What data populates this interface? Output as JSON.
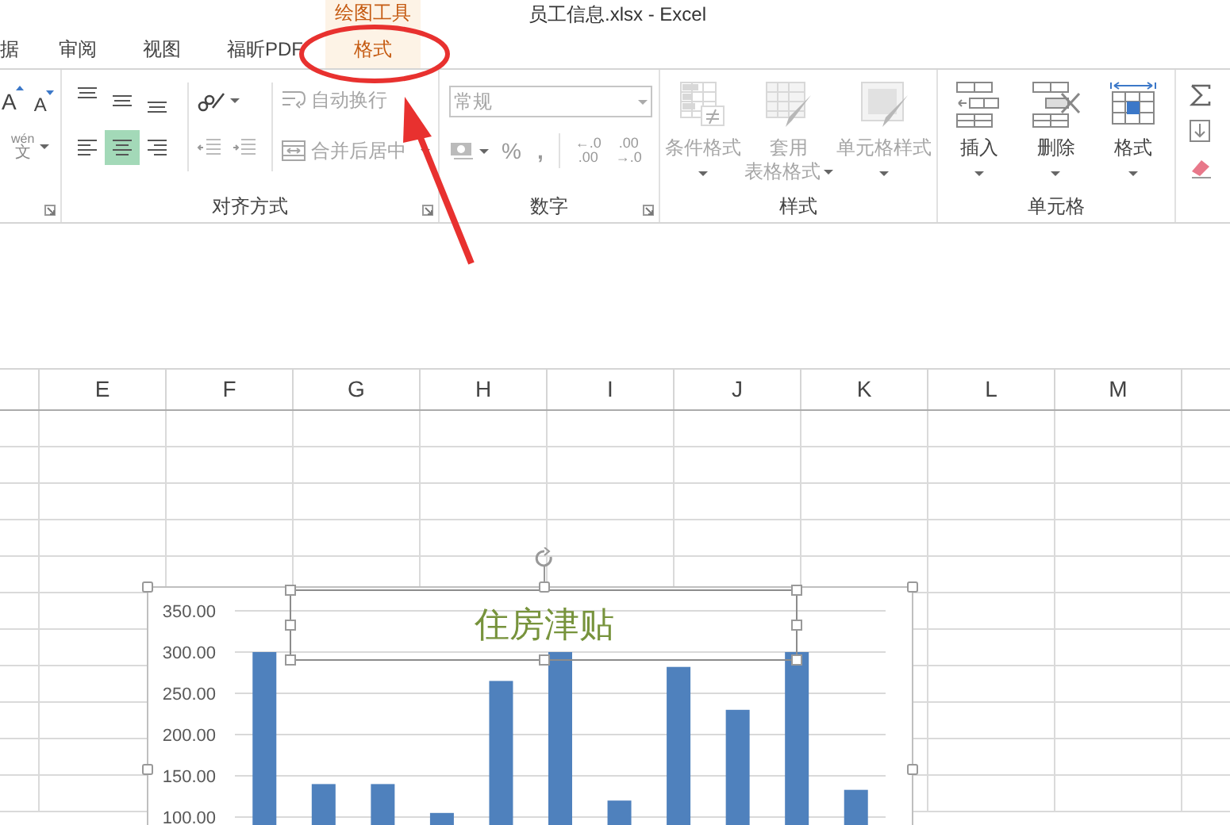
{
  "title_bar": {
    "context_label": "绘图工具",
    "title": "员工信息.xlsx - Excel"
  },
  "tabs": [
    {
      "label": "据",
      "selected": false
    },
    {
      "label": "审阅",
      "selected": false
    },
    {
      "label": "视图",
      "selected": false
    },
    {
      "label": "福昕PDF",
      "selected": false
    },
    {
      "label": "格式",
      "selected": true
    }
  ],
  "ribbon": {
    "font_group": {
      "grow_font": "A",
      "shrink_font": "A",
      "phonetic_top": "wén",
      "phonetic_bottom": "文"
    },
    "alignment_group": {
      "label": "对齐方式",
      "align_buttons": [
        {
          "kind": "top",
          "selected": false
        },
        {
          "kind": "middle",
          "selected": false
        },
        {
          "kind": "bottom",
          "selected": false
        },
        {
          "kind": "left",
          "selected": false
        },
        {
          "kind": "center",
          "selected": true
        },
        {
          "kind": "right",
          "selected": false
        }
      ],
      "wrap_text": {
        "label": "自动换行",
        "disabled": true
      },
      "merge_center": {
        "label": "合并后居中",
        "disabled": true
      }
    },
    "number_group": {
      "label": "数字",
      "format_dropdown": {
        "value": "常规",
        "disabled": true
      },
      "percent": "%",
      "comma": ",",
      "increase_decimal": {
        "top": "←.0",
        "bottom": ".00"
      },
      "decrease_decimal": {
        "top": ".00",
        "bottom": "→.0"
      }
    },
    "styles_group": {
      "label": "样式",
      "commands": [
        {
          "kind": "conditional",
          "label_lines": [
            "条件格式"
          ],
          "disabled": true
        },
        {
          "kind": "table",
          "label_lines": [
            "套用",
            "表格格式"
          ],
          "disabled": true
        },
        {
          "kind": "cellstyle",
          "label_lines": [
            "单元格样式"
          ],
          "disabled": true
        }
      ]
    },
    "cells_group": {
      "label": "单元格",
      "commands": [
        {
          "kind": "insert",
          "label_lines": [
            "插入"
          ],
          "disabled": false
        },
        {
          "kind": "delete",
          "label_lines": [
            "删除"
          ],
          "disabled": false
        },
        {
          "kind": "format",
          "label_lines": [
            "格式"
          ],
          "disabled": false
        }
      ]
    },
    "editing_group": {
      "items": [
        {
          "kind": "sum"
        },
        {
          "kind": "fill"
        },
        {
          "kind": "clear"
        }
      ]
    }
  },
  "sheet": {
    "columns": [
      "E",
      "F",
      "G",
      "H",
      "I",
      "J",
      "K",
      "L",
      "M"
    ]
  },
  "chart": {
    "title": "住房津贴",
    "chart_data": {
      "type": "bar",
      "grid": true,
      "values": [
        300,
        140,
        140,
        105,
        265,
        300,
        120,
        282,
        230,
        300,
        133
      ],
      "ylim": [
        0,
        350
      ],
      "yticks": [
        {
          "value": 100,
          "label": "100.00"
        },
        {
          "value": 150,
          "label": "150.00"
        },
        {
          "value": 200,
          "label": "200.00"
        },
        {
          "value": 250,
          "label": "250.00"
        },
        {
          "value": 300,
          "label": "300.00"
        },
        {
          "value": 350,
          "label": "350.00"
        }
      ]
    }
  }
}
